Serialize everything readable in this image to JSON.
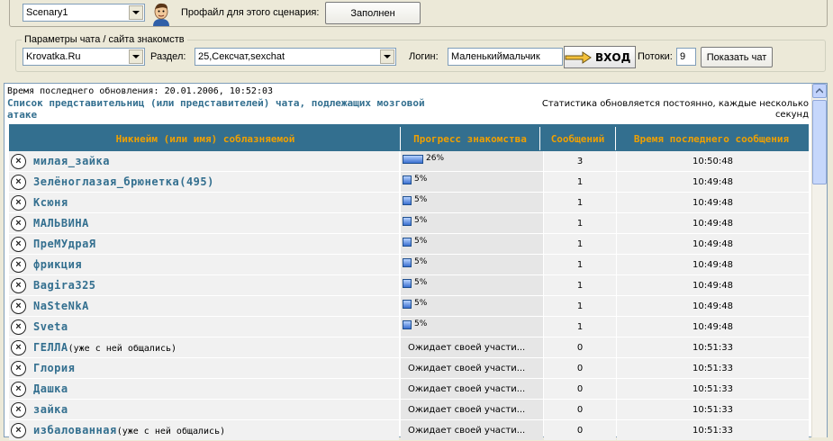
{
  "scenario": {
    "selected": "Scenary1",
    "profile_label": "Профайл для этого сценария:",
    "profile_button": "Заполнен"
  },
  "chat_params": {
    "group_title": "Параметры чата / сайта знакомств",
    "site": "Krovatka.Ru",
    "section_label": "Раздел:",
    "section_value": "25,Сексчат,sexchat",
    "login_label": "Логин:",
    "login_value": "Маленькиймальчик",
    "enter_button": "ВХОД",
    "threads_label": "Потоки:",
    "threads_value": "9",
    "show_chat_button": "Показать чат"
  },
  "content": {
    "last_update": "Время последнего обновления: 20.01.2006, 10:52:03",
    "list_title_line1": "Список представительниц (или представителей) чата, подлежащих мозговой",
    "list_title_line2": "атаке",
    "stats_note_line1": "Статистика обновляется постоянно, каждые несколько",
    "stats_note_line2": "секунд",
    "columns": {
      "name": "Никнейм (или имя) соблазняемой",
      "progress": "Прогресс знакомства",
      "messages": "Сообщений",
      "last_time": "Время последнего сообщения"
    },
    "rows": [
      {
        "name": "милая_зайка",
        "note": "",
        "progress": 26,
        "progress_text": "26%",
        "waiting": "",
        "messages": "3",
        "time": "10:50:48"
      },
      {
        "name": "Зелёноглазая_брюнетка(495)",
        "note": "",
        "progress": 5,
        "progress_text": "5%",
        "waiting": "",
        "messages": "1",
        "time": "10:49:48"
      },
      {
        "name": "Ксюня",
        "note": "",
        "progress": 5,
        "progress_text": "5%",
        "waiting": "",
        "messages": "1",
        "time": "10:49:48"
      },
      {
        "name": "МАЛЬВИНА",
        "note": "",
        "progress": 5,
        "progress_text": "5%",
        "waiting": "",
        "messages": "1",
        "time": "10:49:48"
      },
      {
        "name": "ПреМУдраЯ",
        "note": "",
        "progress": 5,
        "progress_text": "5%",
        "waiting": "",
        "messages": "1",
        "time": "10:49:48"
      },
      {
        "name": "фрикция",
        "note": "",
        "progress": 5,
        "progress_text": "5%",
        "waiting": "",
        "messages": "1",
        "time": "10:49:48"
      },
      {
        "name": "Bagira325",
        "note": "",
        "progress": 5,
        "progress_text": "5%",
        "waiting": "",
        "messages": "1",
        "time": "10:49:48"
      },
      {
        "name": "NaSteNkA",
        "note": "",
        "progress": 5,
        "progress_text": "5%",
        "waiting": "",
        "messages": "1",
        "time": "10:49:48"
      },
      {
        "name": "Sveta",
        "note": "",
        "progress": 5,
        "progress_text": "5%",
        "waiting": "",
        "messages": "1",
        "time": "10:49:48"
      },
      {
        "name": "ГЕЛЛА",
        "note": "(уже с ней общались)",
        "progress": 0,
        "progress_text": "",
        "waiting": "Ожидает своей участи...",
        "messages": "0",
        "time": "10:51:33"
      },
      {
        "name": "Глория",
        "note": "",
        "progress": 0,
        "progress_text": "",
        "waiting": "Ожидает своей участи...",
        "messages": "0",
        "time": "10:51:33"
      },
      {
        "name": "Дашка",
        "note": "",
        "progress": 0,
        "progress_text": "",
        "waiting": "Ожидает своей участи...",
        "messages": "0",
        "time": "10:51:33"
      },
      {
        "name": "зайка",
        "note": "",
        "progress": 0,
        "progress_text": "",
        "waiting": "Ожидает своей участи...",
        "messages": "0",
        "time": "10:51:33"
      },
      {
        "name": "избалованная",
        "note": "(уже с ней общались)",
        "progress": 0,
        "progress_text": "",
        "waiting": "Ожидает своей участи...",
        "messages": "0",
        "time": "10:51:33"
      }
    ]
  }
}
